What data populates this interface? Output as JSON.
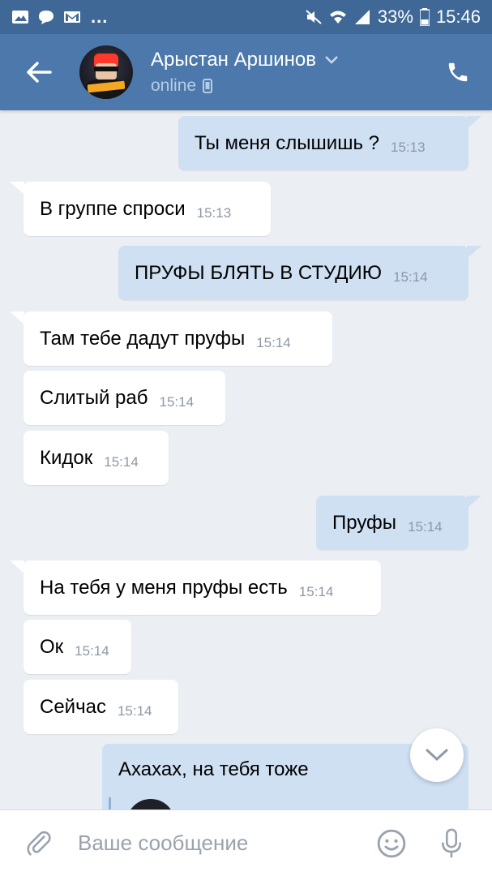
{
  "status_bar": {
    "battery_text": "33%",
    "time": "15:46",
    "icons": [
      "image-icon",
      "message-icon",
      "gmail-icon",
      "more-icon",
      "mute-icon",
      "wifi-icon",
      "signal-icon",
      "battery-icon"
    ]
  },
  "header": {
    "contact_name": "Арыстан Аршинов",
    "status": "online",
    "icons": [
      "back-arrow-icon",
      "chevron-down-icon",
      "mobile-device-icon",
      "phone-icon"
    ]
  },
  "messages": [
    {
      "direction": "out",
      "text": "Ты меня слышишь ?",
      "time": "15:13"
    },
    {
      "direction": "in",
      "text": "В группе спроси",
      "time": "15:13"
    },
    {
      "direction": "out",
      "text": "ПРУФЫ БЛЯТЬ В СТУДИЮ",
      "time": "15:14"
    },
    {
      "direction": "in",
      "text": "Там тебе дадут пруфы",
      "time": "15:14"
    },
    {
      "direction": "in",
      "text": "Слитый раб",
      "time": "15:14"
    },
    {
      "direction": "in",
      "text": "Кидок",
      "time": "15:14"
    },
    {
      "direction": "out",
      "text": "Пруфы",
      "time": "15:14"
    },
    {
      "direction": "in",
      "text": "На тебя у меня пруфы есть",
      "time": "15:14"
    },
    {
      "direction": "in",
      "text": "Ок",
      "time": "15:14"
    },
    {
      "direction": "in",
      "text": "Сейчас",
      "time": "15:14"
    }
  ],
  "partial_message": {
    "direction": "out",
    "text": "Ахахах, на тебя тоже"
  },
  "composer": {
    "placeholder": "Ваше сообщение"
  },
  "colors": {
    "status_bar": "#3f6896",
    "header": "#4c78ab",
    "chat_background": "#ebeef2",
    "incoming_bubble": "#ffffff",
    "outgoing_bubble": "#cfe0f3"
  }
}
